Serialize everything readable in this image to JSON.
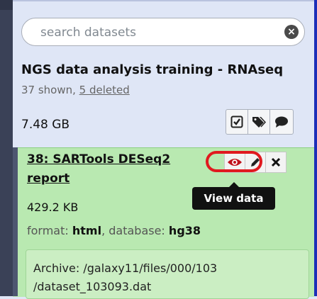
{
  "search": {
    "placeholder": "search datasets"
  },
  "history": {
    "name": "NGS data analysis training - RNAseq",
    "shown": "37 shown, ",
    "deleted": "5 deleted",
    "size": "7.48 GB"
  },
  "dataset": {
    "hid_title": "38: SARTools DESeq2 report",
    "size": "429.2 KB",
    "format_label": "format:",
    "format": "html",
    "database_label": "database:",
    "database": "hg38",
    "info_line1": "Archive: /galaxy11/files/000/103",
    "info_line2": "/dataset_103093.dat"
  },
  "tooltip": {
    "view": "View data"
  },
  "colors": {
    "dataset_ok_bg": "#b9e9b1",
    "highlight": "#e0191f",
    "eye_icon": "#c0121b",
    "history_bg": "#dfe6f6"
  },
  "icons": [
    "clear-icon",
    "check-square-icon",
    "tags-icon",
    "comment-icon",
    "eye-icon",
    "pencil-icon",
    "close-icon"
  ]
}
